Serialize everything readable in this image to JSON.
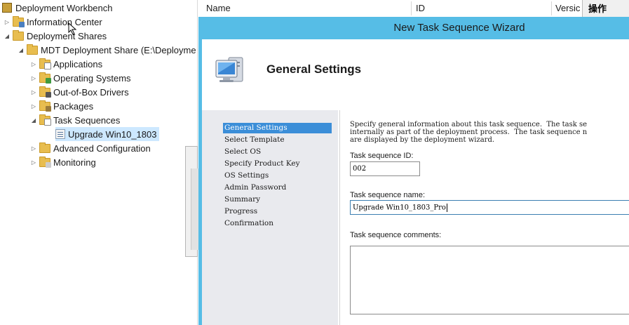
{
  "tree": {
    "root": "Deployment Workbench",
    "items": [
      {
        "label": "Information Center"
      },
      {
        "label": "Deployment Shares"
      },
      {
        "label": "MDT Deployment Share (E:\\Deployme"
      },
      {
        "label": "Applications"
      },
      {
        "label": "Operating Systems"
      },
      {
        "label": "Out-of-Box Drivers"
      },
      {
        "label": "Packages"
      },
      {
        "label": "Task Sequences"
      },
      {
        "label": "Upgrade Win10_1803"
      },
      {
        "label": "Advanced Configuration"
      },
      {
        "label": "Monitoring"
      }
    ]
  },
  "columns": {
    "name": "Name",
    "id": "ID",
    "version": "Versic",
    "actions": "操作"
  },
  "wizard": {
    "title": "New Task Sequence Wizard",
    "page_title": "General Settings",
    "nav": [
      "General Settings",
      "Select Template",
      "Select OS",
      "Specify Product Key",
      "OS Settings",
      "Admin Password",
      "Summary",
      "Progress",
      "Confirmation"
    ],
    "description": "Specify general information about this task sequence.  The task se\ninternally as part of the deployment process.  The task sequence n\nare displayed by the deployment wizard.",
    "fields": {
      "id_label": "Task sequence ID:",
      "id_value": "002",
      "name_label": "Task sequence name:",
      "name_value": "Upgrade Win10_1803_Pro",
      "comments_label": "Task sequence comments:",
      "comments_value": ""
    }
  },
  "colors": {
    "wizard_bg": "#56bde6",
    "nav_active": "#3b8ed8",
    "nav_bg": "#e9eaee",
    "folder": "#e8bd4f"
  }
}
